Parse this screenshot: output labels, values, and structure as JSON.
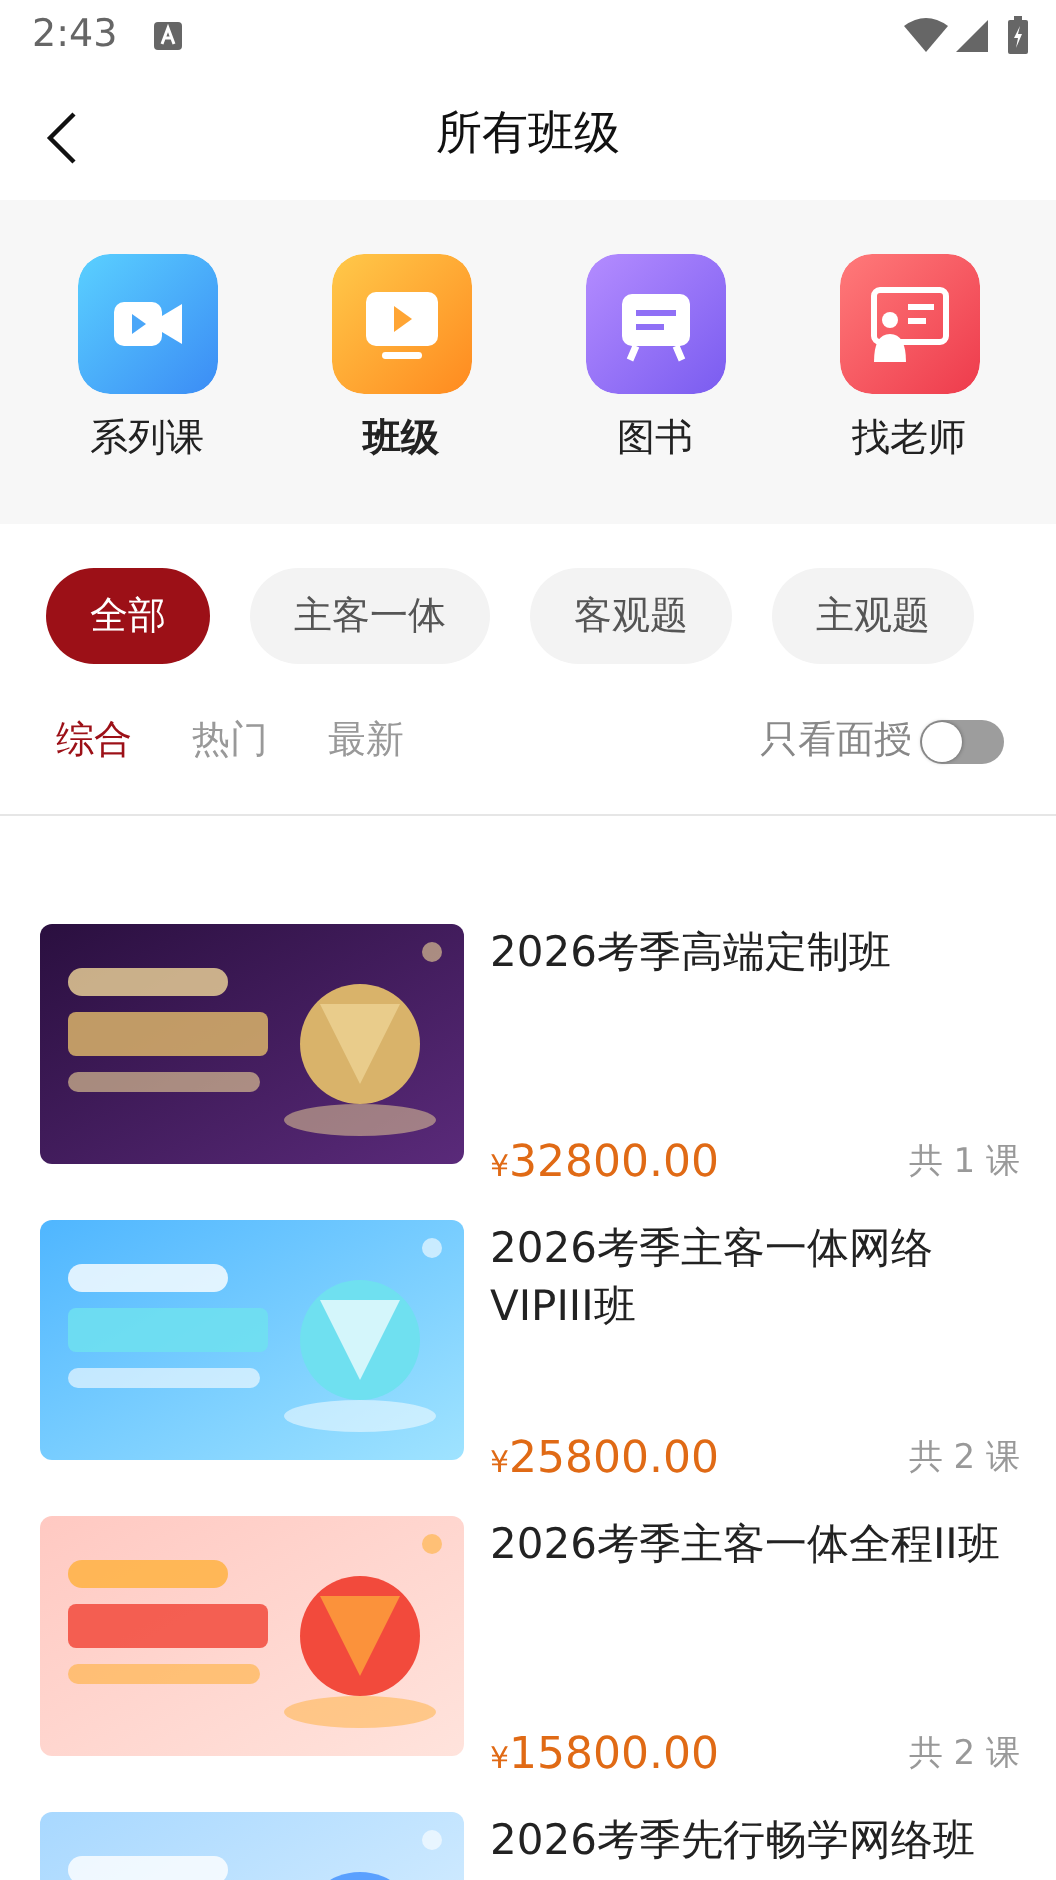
{
  "status_bar": {
    "time": "2:43"
  },
  "header": {
    "title": "所有班级"
  },
  "categories": [
    {
      "label": "系列课",
      "selected": false
    },
    {
      "label": "班级",
      "selected": true
    },
    {
      "label": "图书",
      "selected": false
    },
    {
      "label": "找老师",
      "selected": false
    }
  ],
  "filters": [
    {
      "label": "全部",
      "selected": true
    },
    {
      "label": "主客一体",
      "selected": false
    },
    {
      "label": "客观题",
      "selected": false
    },
    {
      "label": "主观题",
      "selected": false
    }
  ],
  "sort_tabs": [
    {
      "label": "综合",
      "selected": true
    },
    {
      "label": "热门",
      "selected": false
    },
    {
      "label": "最新",
      "selected": false
    }
  ],
  "face_only": {
    "label": "只看面授",
    "on": false
  },
  "classes": [
    {
      "title": "2026考季高端定制班",
      "currency": "¥",
      "price": "32800.00",
      "count": "共 1 课"
    },
    {
      "title": "2026考季主客一体网络VIPIII班",
      "currency": "¥",
      "price": "25800.00",
      "count": "共 2 课"
    },
    {
      "title": "2026考季主客一体全程II班",
      "currency": "¥",
      "price": "15800.00",
      "count": "共 2 课"
    },
    {
      "title": "2026考季先行畅学网络班"
    }
  ]
}
